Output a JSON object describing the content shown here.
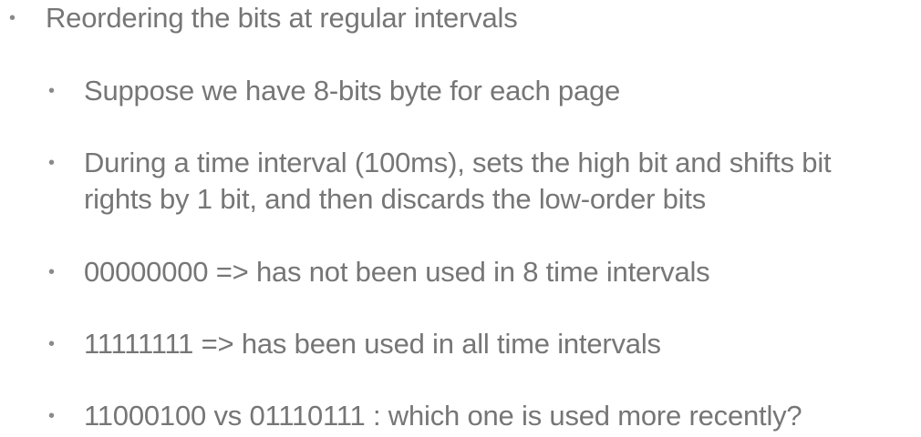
{
  "slide": {
    "bullet_char": "•",
    "main_point": "Reordering the bits at regular intervals",
    "sub_points": [
      "Suppose we have 8-bits byte for each page",
      "During a time interval (100ms), sets the high bit and shifts bit",
      "rights by 1 bit, and then discards the low-order bits",
      "00000000 => has not been used in 8 time intervals",
      "11111111 => has been used in all time intervals",
      "11000100  vs 01110111 : which one is used more recently?"
    ]
  }
}
